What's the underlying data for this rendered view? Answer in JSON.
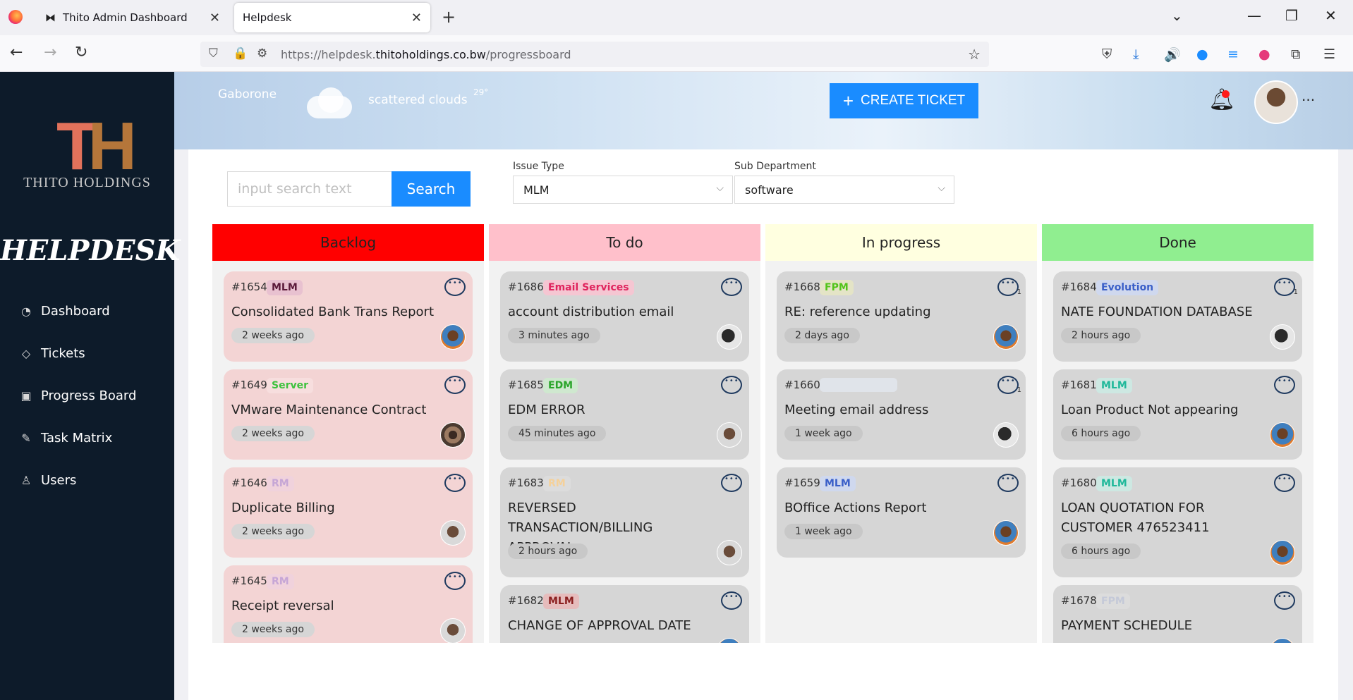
{
  "browser": {
    "tabs": [
      {
        "title": "Thito Admin Dashboard",
        "active": false
      },
      {
        "title": "Helpdesk",
        "active": true
      }
    ],
    "url_prefix": "https://helpdesk.",
    "url_domain": "thitoholdings.co.bw",
    "url_path": "/progressboard"
  },
  "sidebar": {
    "logo_text": "THITO HOLDINGS",
    "title": "HELPDESK",
    "items": [
      {
        "label": "Dashboard",
        "icon": "dashboard-icon"
      },
      {
        "label": "Tickets",
        "icon": "tag-icon"
      },
      {
        "label": "Progress Board",
        "icon": "board-icon"
      },
      {
        "label": "Task Matrix",
        "icon": "edit-icon"
      },
      {
        "label": "Users",
        "icon": "user-icon"
      }
    ]
  },
  "header": {
    "city": "Gaborone",
    "weather": "scattered clouds",
    "temperature": "29°",
    "create_ticket_label": "CREATE TICKET"
  },
  "filters": {
    "search_placeholder": "input search text",
    "search_label": "Search",
    "issue_type_label": "Issue Type",
    "issue_type_value": "MLM",
    "sub_department_label": "Sub Department",
    "sub_department_value": "software"
  },
  "colors": {
    "accent": "#1a8cff",
    "backlog": "#ff0000",
    "todo": "#ffc0cb",
    "inprogress": "#ffffe0",
    "done": "#90ee90"
  },
  "columns": [
    {
      "name": "Backlog",
      "cards": [
        {
          "id": "#1654",
          "tag": "MLM",
          "title": "Consolidated Bank Trans Report",
          "time": "2 weeks ago"
        },
        {
          "id": "#1649",
          "tag": "Server",
          "title": "VMware Maintenance Contract",
          "time": "2 weeks ago"
        },
        {
          "id": "#1646",
          "tag": "RM",
          "title": "Duplicate Billing",
          "time": "2 weeks ago"
        },
        {
          "id": "#1645",
          "tag": "RM",
          "title": "Receipt reversal",
          "time": "2 weeks ago"
        }
      ]
    },
    {
      "name": "To do",
      "cards": [
        {
          "id": "#1686",
          "tag": "Email Services",
          "title": "account distribution email",
          "time": "3 minutes ago"
        },
        {
          "id": "#1685",
          "tag": "EDM",
          "title": "EDM ERROR",
          "time": "45 minutes ago"
        },
        {
          "id": "#1683",
          "tag": "RM",
          "title": "REVERSED TRANSACTION/BILLING APPROVAL",
          "time": "2 hours ago"
        },
        {
          "id": "#1682",
          "tag": "MLM",
          "title": "CHANGE OF APPROVAL DATE",
          "time": ""
        }
      ]
    },
    {
      "name": "In progress",
      "cards": [
        {
          "id": "#1668",
          "tag": "FPM",
          "title": "RE: reference updating",
          "time": "2 days ago",
          "comments": "1"
        },
        {
          "id": "#1660",
          "tag": "",
          "title": "Meeting email address",
          "time": "1 week ago",
          "comments": "1"
        },
        {
          "id": "#1659",
          "tag": "MLM",
          "title": "BOffice Actions Report",
          "time": "1 week ago"
        }
      ]
    },
    {
      "name": "Done",
      "cards": [
        {
          "id": "#1684",
          "tag": "Evolution",
          "title": "NATE FOUNDATION DATABASE",
          "time": "2 hours ago",
          "comments": "1"
        },
        {
          "id": "#1681",
          "tag": "MLM",
          "title": "Loan Product Not appearing",
          "time": "6 hours ago"
        },
        {
          "id": "#1680",
          "tag": "MLM",
          "title": "LOAN QUOTATION FOR CUSTOMER 476523411",
          "time": "6 hours ago"
        },
        {
          "id": "#1678",
          "tag": "FPM",
          "title": "PAYMENT SCHEDULE",
          "time": ""
        }
      ]
    }
  ]
}
